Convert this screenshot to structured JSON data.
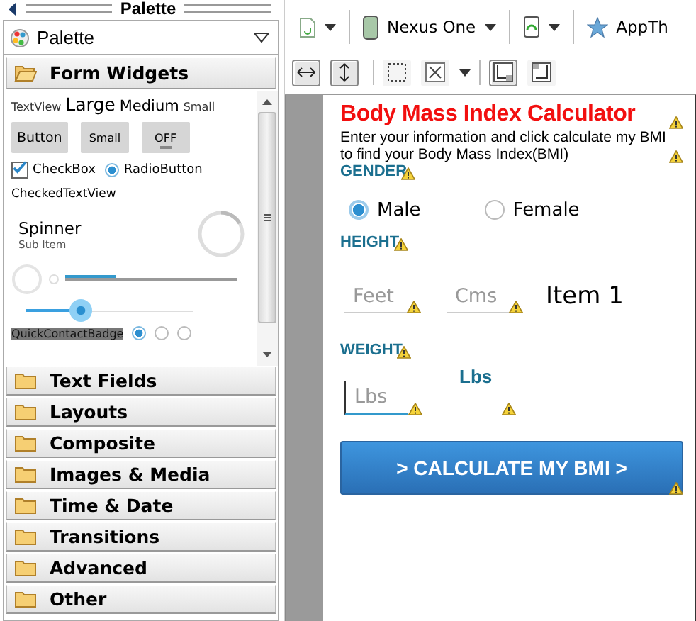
{
  "palette": {
    "title": "Palette",
    "dropdown": "Palette",
    "open_category": {
      "label": "Form Widgets",
      "expanded": true
    },
    "widgets": {
      "text_sizes": [
        "TextView",
        "Large",
        "Medium",
        "Small"
      ],
      "buttons": [
        "Button",
        "Small",
        "OFF"
      ],
      "checkbox": {
        "label": "CheckBox",
        "checked": true
      },
      "radio": {
        "label": "RadioButton",
        "selected": true
      },
      "checked_text_view": "CheckedTextView",
      "spinner": {
        "title": "Spinner",
        "subtitle": "Sub Item"
      },
      "progress": {
        "level": 0.3
      },
      "seekbar": {
        "level": 0.33
      },
      "quick_contact_badge": "QuickContactBadge",
      "radio_dots": [
        {
          "selected": true
        },
        {
          "selected": false
        },
        {
          "selected": false
        }
      ]
    },
    "categories": [
      {
        "label": "Text Fields",
        "expanded": false
      },
      {
        "label": "Layouts",
        "expanded": false
      },
      {
        "label": "Composite",
        "expanded": false
      },
      {
        "label": "Images & Media",
        "expanded": false
      },
      {
        "label": "Time & Date",
        "expanded": false
      },
      {
        "label": "Transitions",
        "expanded": false
      },
      {
        "label": "Advanced",
        "expanded": false
      },
      {
        "label": "Other",
        "expanded": false
      }
    ]
  },
  "toolbar": {
    "device": "Nexus One",
    "theme": "AppTh"
  },
  "screen": {
    "title": "Body Mass Index Calculator",
    "intro": "Enter your information and click calculate my BMI to find your Body Mass Index(BMI)",
    "gender_label": "GENDER",
    "gender_options": [
      {
        "label": "Male",
        "selected": true
      },
      {
        "label": "Female",
        "selected": false
      }
    ],
    "height_label": "HEIGHT",
    "height_fields": [
      {
        "placeholder": "Feet"
      },
      {
        "placeholder": "Cms"
      }
    ],
    "height_spinner": "Item 1",
    "weight_label": "WEIGHT",
    "weight_field": {
      "placeholder": "Lbs"
    },
    "weight_unit": "Lbs",
    "button": "> CALCULATE MY BMI >"
  }
}
